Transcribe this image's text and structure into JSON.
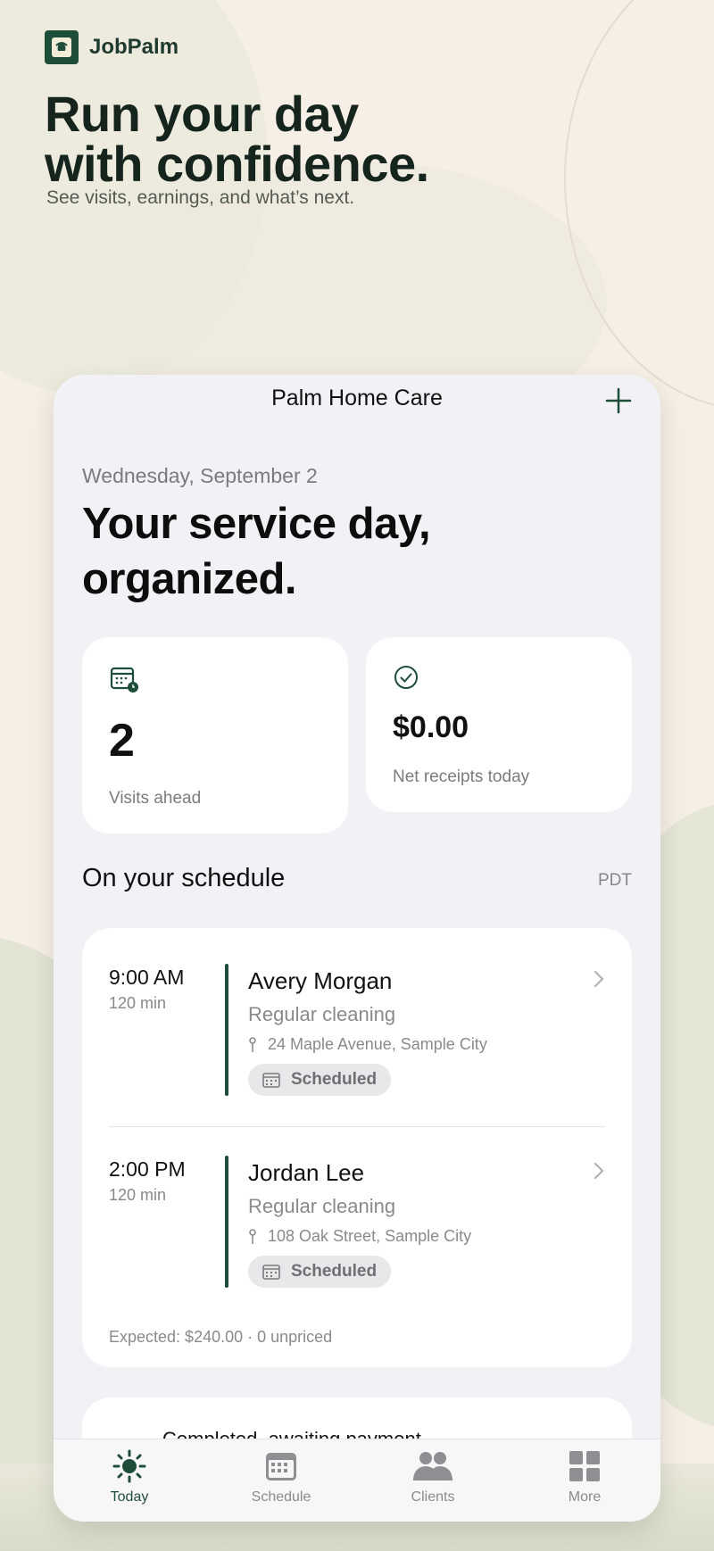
{
  "brand": {
    "name": "JobPalm"
  },
  "hero": {
    "title_line1": "Run your day",
    "title_line2": "with confidence.",
    "subtitle": "See visits, earnings, and what’s next."
  },
  "app": {
    "nav_title": "Palm Home Care",
    "date": "Wednesday, September 2",
    "headline_line1": "Your service day,",
    "headline_line2": "organized.",
    "stats": {
      "visits_value": "2",
      "visits_label": "Visits ahead",
      "receipts_value": "$0.00",
      "receipts_label": "Net receipts today"
    },
    "schedule": {
      "heading": "On your schedule",
      "timezone": "PDT",
      "visits": [
        {
          "time": "9:00 AM",
          "duration": "120 min",
          "client": "Avery Morgan",
          "service": "Regular cleaning",
          "address": "24 Maple Avenue, Sample City",
          "status": "Scheduled"
        },
        {
          "time": "2:00 PM",
          "duration": "120 min",
          "client": "Jordan Lee",
          "service": "Regular cleaning",
          "address": "108 Oak Street, Sample City",
          "status": "Scheduled"
        }
      ],
      "expected": "Expected: $240.00 · 0 unpriced"
    },
    "peek_card_title": "Completed, awaiting payment",
    "tabs": [
      {
        "label": "Today",
        "icon": "sun-icon",
        "active": true
      },
      {
        "label": "Schedule",
        "icon": "calendar-icon",
        "active": false
      },
      {
        "label": "Clients",
        "icon": "people-icon",
        "active": false
      },
      {
        "label": "More",
        "icon": "grid-icon",
        "active": false
      }
    ]
  },
  "colors": {
    "accent": "#1e4d3a",
    "background": "#f5efe6",
    "card": "#ffffff",
    "surface": "#f1f1f6"
  }
}
